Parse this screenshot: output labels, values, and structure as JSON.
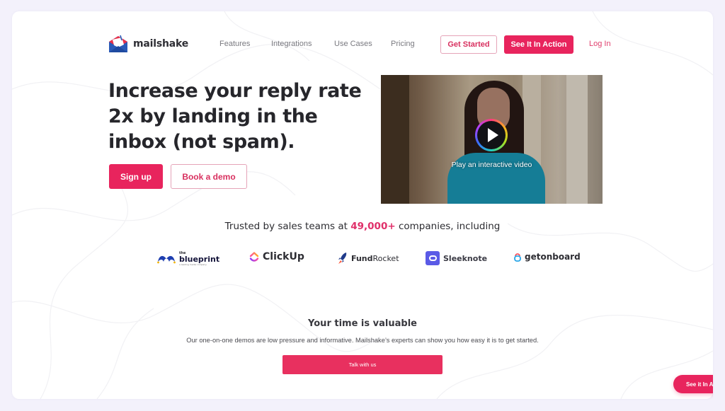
{
  "brand": {
    "name": "mailshake",
    "accent": "#e8245d",
    "background": "#f3f1fb"
  },
  "header": {
    "logo_icon": "envelope-icon",
    "nav": [
      {
        "label": "Features"
      },
      {
        "label": "Integrations"
      },
      {
        "label": "Use Cases"
      },
      {
        "label": "Pricing"
      }
    ],
    "get_started_label": "Get Started",
    "see_in_action_label": "See It In Action",
    "login_label": "Log In"
  },
  "hero": {
    "title": "Increase your reply rate 2x by landing in the inbox (not spam).",
    "signup_label": "Sign up",
    "demo_label": "Book a demo",
    "video": {
      "play_icon": "play-icon",
      "caption": "Play an interactive video"
    }
  },
  "trust": {
    "prefix": "Trusted by sales teams at ",
    "highlight": "49,000+",
    "suffix": " companies, including",
    "companies": [
      {
        "the": "the",
        "name": "blueprint",
        "tagline": "a leading media company"
      },
      {
        "name": "ClickUp"
      },
      {
        "name_bold": "Fund",
        "name_rest": "Rocket"
      },
      {
        "name": "Sleeknote"
      },
      {
        "name": "getonboard"
      }
    ]
  },
  "cta": {
    "title": "Your time is valuable",
    "description": "Our one-on-one demos are low pressure and informative. Mailshake’s experts can show you how easy it is to get started.",
    "button_label": "Talk with us"
  },
  "floating": {
    "label": "See it In Action"
  }
}
